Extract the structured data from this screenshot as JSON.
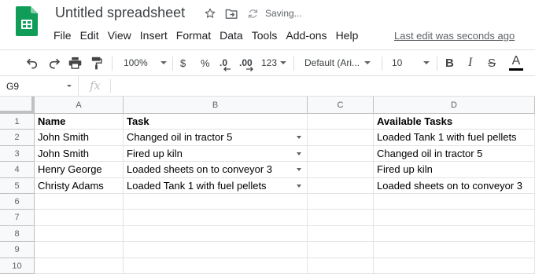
{
  "app": {
    "document_title": "Untitled spreadsheet",
    "save_status": "Saving...",
    "last_edit": "Last edit was seconds ago",
    "brand_color": "#0f9d58"
  },
  "menu": [
    "File",
    "Edit",
    "View",
    "Insert",
    "Format",
    "Data",
    "Tools",
    "Add-ons",
    "Help"
  ],
  "toolbar": {
    "zoom": "100%",
    "currency": "$",
    "percent": "%",
    "decrease_decimals": ".0",
    "increase_decimals": ".00",
    "more_formats": "123",
    "font_family": "Default (Ari...",
    "font_size": "10",
    "bold": "B",
    "italic": "I",
    "strikethrough": "S",
    "text_color": "A"
  },
  "formula_bar": {
    "name_box": "G9",
    "fx_label": "fx",
    "formula": ""
  },
  "sheet": {
    "columns": [
      "A",
      "B",
      "C",
      "D"
    ],
    "row_numbers": [
      "1",
      "2",
      "3",
      "4",
      "5",
      "6",
      "7",
      "8",
      "9",
      "10"
    ],
    "rows": [
      [
        "Name",
        "Task",
        "",
        "Available Tasks"
      ],
      [
        "John Smith",
        "Changed oil in tractor 5",
        "",
        "Loaded Tank 1 with fuel pellets"
      ],
      [
        "John Smith",
        "Fired up kiln",
        "",
        "Changed oil in tractor 5"
      ],
      [
        "Henry George",
        "Loaded sheets on to conveyor 3",
        "",
        "Fired up kiln"
      ],
      [
        "Christy Adams",
        "Loaded Tank 1 with fuel pellets",
        "",
        "Loaded sheets on to conveyor 3"
      ],
      [
        "",
        "",
        "",
        ""
      ],
      [
        "",
        "",
        "",
        ""
      ],
      [
        "",
        "",
        "",
        ""
      ],
      [
        "",
        "",
        "",
        ""
      ],
      [
        "",
        "",
        "",
        ""
      ]
    ],
    "header_row_bold": true,
    "dropdown_rows_in_column_b": [
      2,
      3,
      4,
      5
    ],
    "selected_cell": "G9"
  }
}
